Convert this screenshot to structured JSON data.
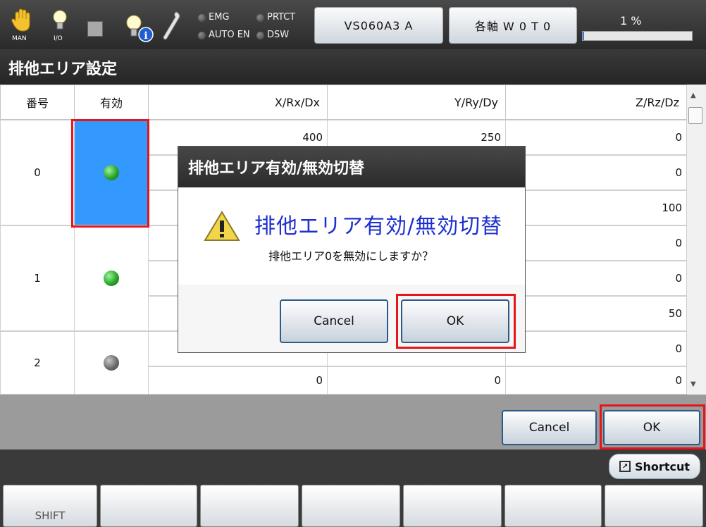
{
  "topbar": {
    "icons": [
      {
        "name": "hand-icon",
        "label": "MAN"
      },
      {
        "name": "bulb-icon",
        "label": "I/O"
      },
      {
        "name": "stop-square-icon",
        "label": ""
      },
      {
        "name": "bulb-info-icon",
        "label": ""
      },
      {
        "name": "wrench-icon",
        "label": ""
      }
    ],
    "leds": {
      "emg": "EMG",
      "prtct": "PRTCT",
      "auto_en": "AUTO EN",
      "dsw": "DSW"
    },
    "robot_button": "VS060A3 A",
    "axis_button": "各軸  W 0 T 0",
    "speed_text": "1 %",
    "speed_value": 1
  },
  "page_title": "排他エリア設定",
  "table": {
    "headers": {
      "number": "番号",
      "enabled": "有効",
      "x": "X/Rx/Dx",
      "y": "Y/Ry/Dy",
      "z": "Z/Rz/Dz"
    },
    "rows": [
      {
        "number": "0",
        "led": "green",
        "x": [
          "400",
          "",
          ""
        ],
        "y": [
          "250",
          "",
          ""
        ],
        "z": [
          "0",
          "0",
          "100"
        ]
      },
      {
        "number": "1",
        "led": "green",
        "x": [
          "",
          "",
          ""
        ],
        "y": [
          "",
          "",
          ""
        ],
        "z": [
          "0",
          "0",
          "50"
        ]
      },
      {
        "number": "2",
        "led": "gray",
        "x": [
          "",
          "0"
        ],
        "y": [
          "",
          "0"
        ],
        "z": [
          "0",
          "0"
        ]
      }
    ]
  },
  "footer": {
    "cancel": "Cancel",
    "ok": "OK",
    "shortcut": "Shortcut",
    "fkeys": [
      "SHIFT",
      "",
      "",
      "",
      "",
      "",
      ""
    ]
  },
  "dialog": {
    "title": "排他エリア有効/無効切替",
    "heading": "排他エリア有効/無効切替",
    "message": "排他エリア0を無効にしますか？",
    "cancel": "Cancel",
    "ok": "OK"
  },
  "colors": {
    "selected_cell": "#3399ff",
    "highlight_frame": "#e8141a",
    "dialog_heading": "#1d2fcf"
  }
}
